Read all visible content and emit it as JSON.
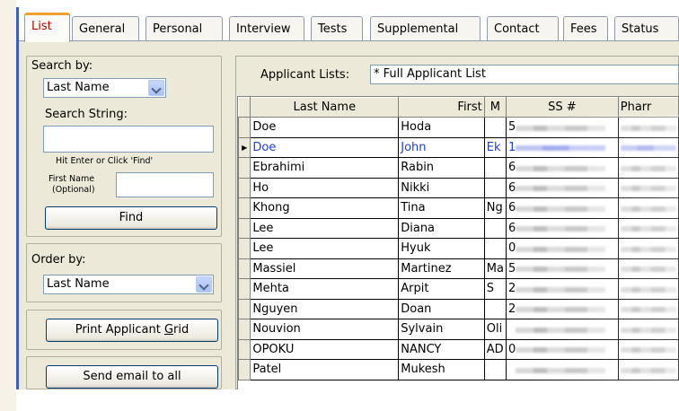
{
  "tabs": [
    {
      "label": "List",
      "active": true
    },
    {
      "label": "General"
    },
    {
      "label": "Personal"
    },
    {
      "label": "Interview"
    },
    {
      "label": "Tests"
    },
    {
      "label": "Supplemental"
    },
    {
      "label": "Contact"
    },
    {
      "label": "Fees"
    },
    {
      "label": "Status"
    }
  ],
  "search": {
    "search_by_label": "Search by:",
    "search_by_value": "Last Name",
    "search_string_label": "Search String:",
    "hint": "Hit Enter or Click 'Find'",
    "first_name_label_1": "First Name",
    "first_name_label_2": "(Optional)",
    "find_button": "Find"
  },
  "order": {
    "label": "Order by:",
    "value": "Last Name"
  },
  "actions": {
    "print_prefix": "Print Applicant ",
    "print_underlined": "G",
    "print_suffix": "rid",
    "email_button": "Send email to all"
  },
  "applicant_lists": {
    "label": "Applicant Lists:",
    "value": "* Full Applicant List"
  },
  "grid": {
    "columns": [
      "Last Name",
      "First",
      "M",
      "SS #",
      "Pharr"
    ],
    "current_row_marker": "▶",
    "rows": [
      {
        "last": "Doe",
        "first": "Hoda",
        "m": "",
        "ss": "5"
      },
      {
        "last": "Doe",
        "first": "John",
        "m": "Ek",
        "ss": "1",
        "current": true
      },
      {
        "last": "Ebrahimi",
        "first": "Rabin",
        "m": "",
        "ss": "6"
      },
      {
        "last": "Ho",
        "first": "Nikki",
        "m": "",
        "ss": "6"
      },
      {
        "last": "Khong",
        "first": "Tina",
        "m": "Ng",
        "ss": "6"
      },
      {
        "last": "Lee",
        "first": "Diana",
        "m": "",
        "ss": "6"
      },
      {
        "last": "Lee",
        "first": "Hyuk",
        "m": "",
        "ss": "0"
      },
      {
        "last": "Massiel",
        "first": "Martinez",
        "m": "Ma",
        "ss": "5"
      },
      {
        "last": "Mehta",
        "first": "Arpit",
        "m": "S",
        "ss": "2"
      },
      {
        "last": "Nguyen",
        "first": "Doan",
        "m": "",
        "ss": "2"
      },
      {
        "last": "Nouvion",
        "first": "Sylvain",
        "m": "Oli",
        "ss": ""
      },
      {
        "last": "OPOKU",
        "first": "NANCY",
        "m": "AD",
        "ss": "0"
      },
      {
        "last": "Patel",
        "first": "Mukesh",
        "m": "",
        "ss": ""
      }
    ]
  },
  "colors": {
    "accent_border": "#3c5fbf",
    "active_tab_text": "#c00000",
    "active_tab_top": "#f0a030",
    "current_row_text": "#1f3ed6",
    "panel_bg": "#ece9d8"
  }
}
